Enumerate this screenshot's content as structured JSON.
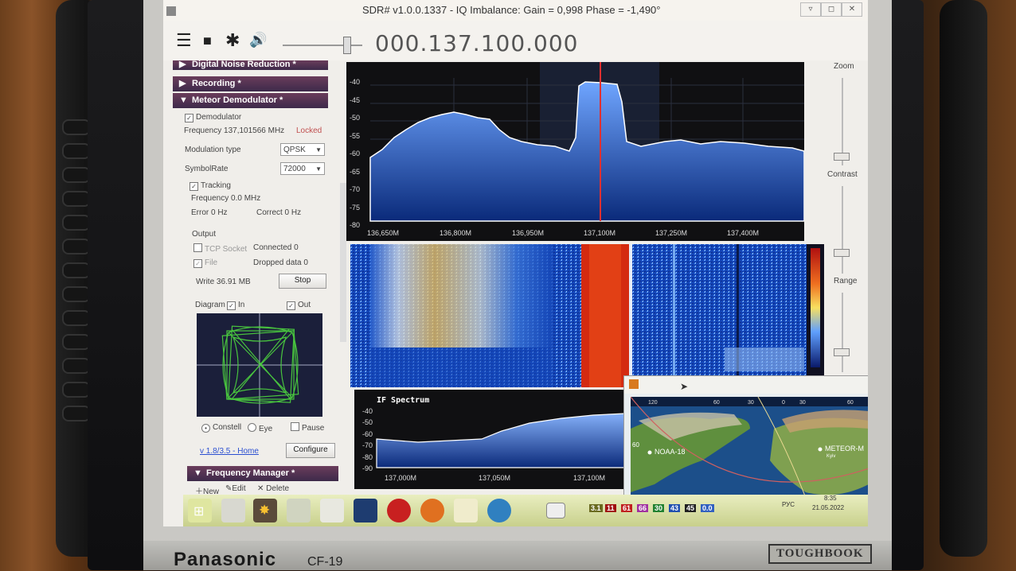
{
  "window": {
    "title": "SDR# v1.0.0.1337 - IQ Imbalance: Gain = 0,998 Phase = -1,490°",
    "minimize": "▿",
    "maximize": "◻",
    "close": "✕"
  },
  "toolbar": {
    "menu_icon": "☰",
    "stop_icon": "■",
    "settings_icon": "✱",
    "volume_icon": "🔊",
    "frequency": "000.137.100.000"
  },
  "panel": {
    "sections": {
      "noise_reduction": "Digital Noise Reduction *",
      "recording": "Recording *",
      "meteor": "Meteor Demodulator *",
      "frequency_manager": "Frequency Manager *"
    },
    "demodulator_label": "Demodulator",
    "frequency_text": "Frequency 137,101566 MHz",
    "locked": "Locked",
    "modulation_label": "Modulation type",
    "modulation_value": "QPSK",
    "symbolrate_label": "SymbolRate",
    "symbolrate_value": "72000",
    "tracking_label": "Tracking",
    "tracking_freq": "Frequency 0.0 MHz",
    "tracking_error": "Error 0 Hz",
    "tracking_correct": "Correct 0 Hz",
    "output_label": "Output",
    "tcp_label": "TCP Socket",
    "connected": "Connected 0",
    "file_label": "File",
    "dropped": "Dropped data 0",
    "write": "Write 36.91 MB",
    "stop_button": "Stop",
    "diagram_label": "Diagram",
    "in_label": "In",
    "out_label": "Out",
    "constell_label": "Constell",
    "eye_label": "Eye",
    "pause_label": "Pause",
    "version_link": "v 1.8/3.5 - Home",
    "configure_button": "Configure",
    "fm_new": "New",
    "fm_edit": "Edit",
    "fm_delete": "Delete"
  },
  "spectrum": {
    "y_ticks": [
      "-40",
      "-45",
      "-50",
      "-55",
      "-60",
      "-65",
      "-70",
      "-75",
      "-80"
    ],
    "x_ticks": [
      "136,650M",
      "136,800M",
      "136,950M",
      "137,100M",
      "137,250M",
      "137,400M"
    ]
  },
  "right": {
    "zoom": "Zoom",
    "contrast": "Contrast",
    "range": "Range"
  },
  "if_spectrum": {
    "title": "IF Spectrum",
    "y_ticks": [
      "-40",
      "-50",
      "-60",
      "-70",
      "-80",
      "-90"
    ],
    "x_ticks": [
      "137,000M",
      "137,050M",
      "137,100M"
    ]
  },
  "map": {
    "top_ticks": [
      "120",
      "60",
      "30",
      "0",
      "30",
      "60"
    ],
    "side_label": "60",
    "sat1": "NOAA-18",
    "sat2": "METEOR-M",
    "city": "Kyiv"
  },
  "taskbar": {
    "tray_numbers": [
      "3.1",
      "11",
      "61",
      "66",
      "30",
      "43",
      "45",
      "0.0"
    ],
    "lang": "РУС",
    "time": "8:35",
    "date": "21.05.2022"
  },
  "device": {
    "brand": "Panasonic",
    "model": "CF-19",
    "tough": "TOUGHBOOK"
  },
  "colors": {
    "spectrum_fill": "#2a6bd1",
    "center_line": "#e03030",
    "section_bg": "#4a2f55"
  }
}
